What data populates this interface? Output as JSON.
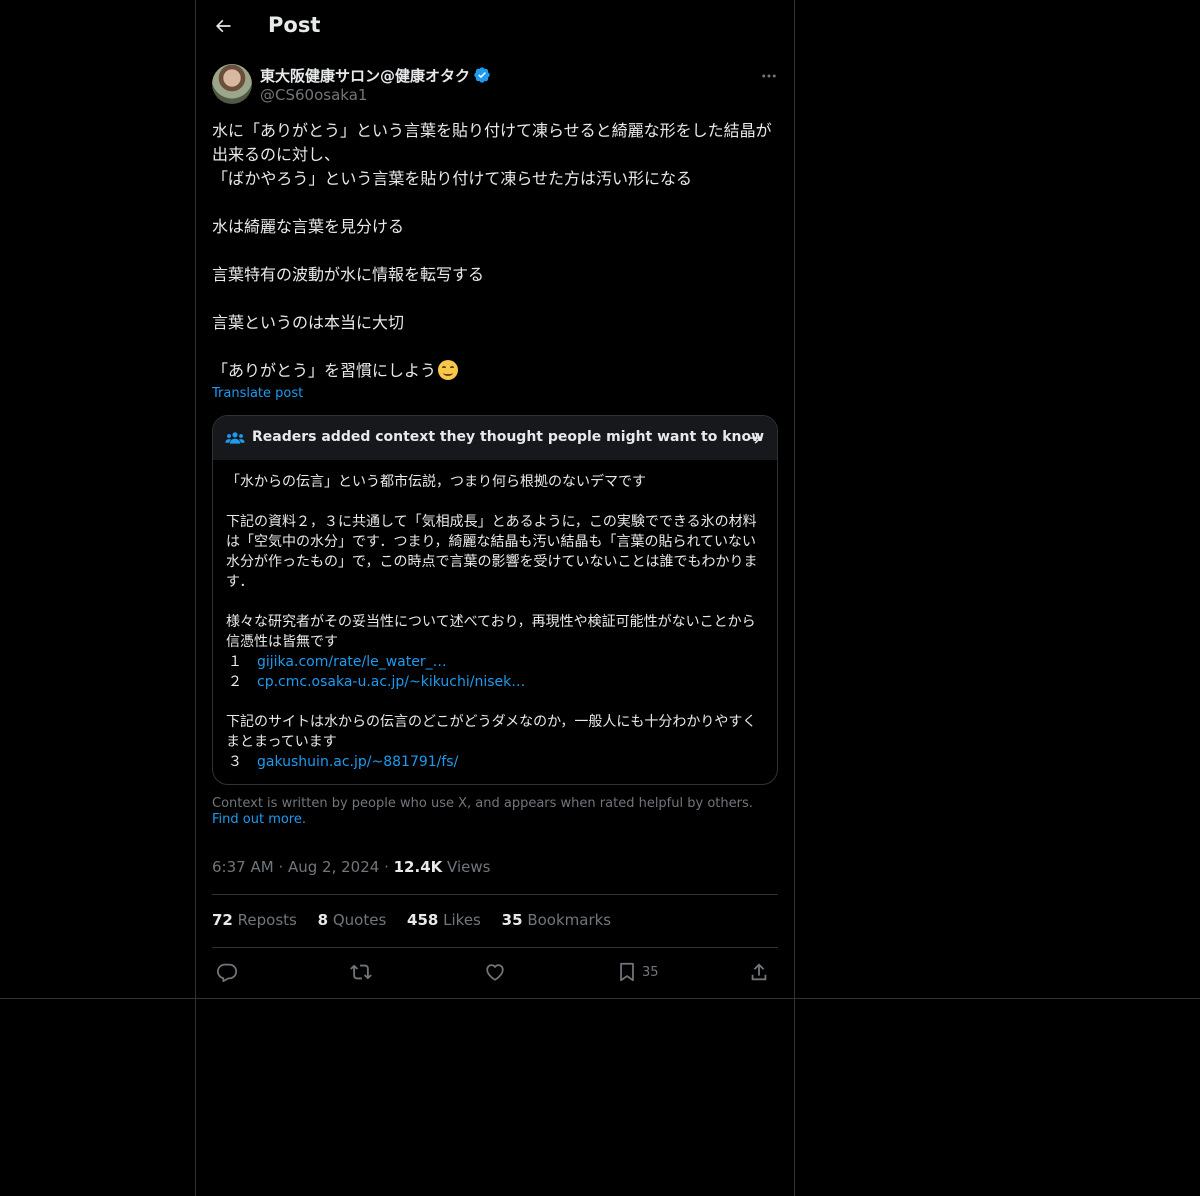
{
  "header": {
    "title": "Post"
  },
  "author": {
    "display_name": "東大阪健康サロン@健康オタク",
    "handle": "@CS60osaka1",
    "verified": true
  },
  "post": {
    "paragraphs": [
      "水に「ありがとう」という言葉を貼り付けて凍らせると綺麗な形をした結晶が出来るのに対し、",
      "「ばかやろう」という言葉を貼り付けて凍らせた方は汚い形になる",
      "",
      "水は綺麗な言葉を見分ける",
      "",
      "言葉特有の波動が水に情報を転写する",
      "",
      "言葉というのは本当に大切",
      "",
      "「ありがとう」を習慣にしよう"
    ],
    "emoji": "smiling-face-emoji",
    "translate_label": "Translate post"
  },
  "community_note": {
    "title": "Readers added context they thought people might want to know",
    "lines": {
      "l1": "「水からの伝言」という都市伝説，つまり何ら根拠のないデマです",
      "l2": "下記の資料２，３に共通して「気相成長」とあるように，この実験でできる氷の材料は「空気中の水分」です．つまり，綺麗な結晶も汚い結晶も「言葉の貼られていない水分が作ったもの」で，この時点で言葉の影響を受けていないことは誰でもわかります．",
      "l3": "様々な研究者がその妥当性について述べており，再現性や検証可能性がないことから信憑性は皆無です",
      "l4": "下記のサイトは水からの伝言のどこがどうダメなのか，一般人にも十分わかりやすくまとまっています"
    },
    "refs": [
      {
        "num": "１",
        "link": "gijika.com/rate/le_water_…"
      },
      {
        "num": "２",
        "link": "cp.cmc.osaka-u.ac.jp/~kikuchi/nisek…"
      },
      {
        "num": "３",
        "link": "gakushuin.ac.jp/~881791/fs/"
      }
    ],
    "footer_text": "Context is written by people who use X, and appears when rated helpful by others.",
    "footer_link": "Find out more."
  },
  "meta": {
    "time": "6:37 AM",
    "date": "Aug 2, 2024",
    "views_count": "12.4K",
    "views_label": "Views"
  },
  "stats": {
    "reposts_count": "72",
    "reposts_label": "Reposts",
    "quotes_count": "8",
    "quotes_label": "Quotes",
    "likes_count": "458",
    "likes_label": "Likes",
    "bookmarks_count": "35",
    "bookmarks_label": "Bookmarks"
  },
  "actions": {
    "bookmark_count": "35"
  },
  "colors": {
    "background": "#000000",
    "text": "#e7e9ea",
    "muted": "#71767b",
    "accent": "#1d9bf0",
    "border": "#2f3336"
  }
}
